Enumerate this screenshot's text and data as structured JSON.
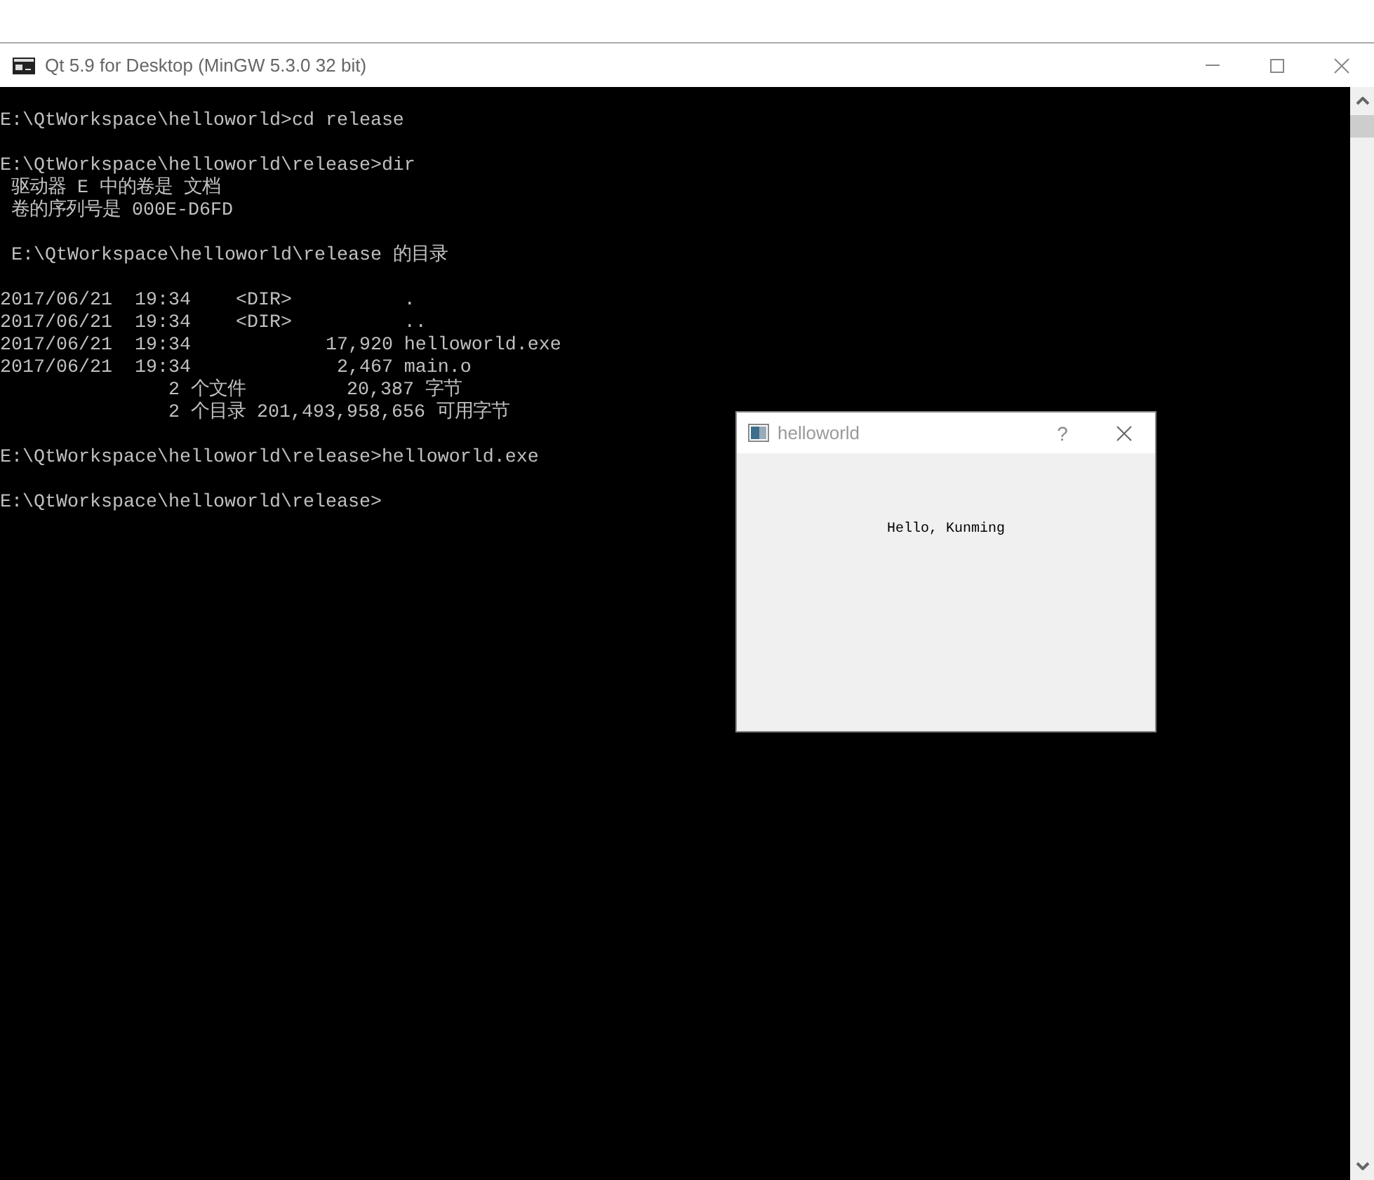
{
  "console_window": {
    "title": "Qt 5.9 for Desktop (MinGW 5.3.0 32 bit)",
    "blocks": [
      {
        "lines": [
          "E:\\QtWorkspace\\helloworld>cd release"
        ]
      },
      {
        "lines": [
          "E:\\QtWorkspace\\helloworld\\release>dir",
          " 驱动器 E 中的卷是 文档",
          " 卷的序列号是 000E-D6FD"
        ]
      },
      {
        "lines": [
          " E:\\QtWorkspace\\helloworld\\release 的目录"
        ]
      },
      {
        "lines": [
          "2017/06/21  19:34    <DIR>          .",
          "2017/06/21  19:34    <DIR>          ..",
          "2017/06/21  19:34            17,920 helloworld.exe",
          "2017/06/21  19:34             2,467 main.o",
          "               2 个文件         20,387 字节",
          "               2 个目录 201,493,958,656 可用字节"
        ]
      },
      {
        "lines": [
          "E:\\QtWorkspace\\helloworld\\release>helloworld.exe"
        ]
      },
      {
        "lines": [
          "E:\\QtWorkspace\\helloworld\\release>"
        ]
      }
    ]
  },
  "dialog": {
    "title": "helloworld",
    "help_button": "?",
    "label": "Hello, Kunming"
  }
}
